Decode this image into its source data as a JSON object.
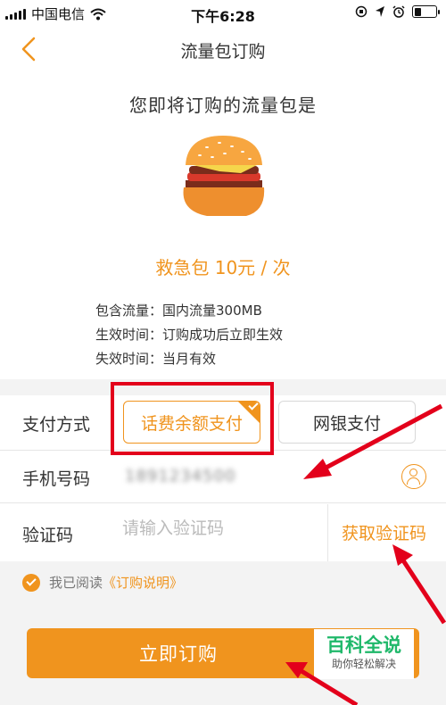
{
  "status_bar": {
    "carrier": "中国电信",
    "time": "下午6:28"
  },
  "nav": {
    "title": "流量包订购"
  },
  "subtitle": "您即将订购的流量包是",
  "package": {
    "name": "救急包 10元 / 次",
    "details": [
      {
        "label": "包含流量：",
        "value": "国内流量300MB"
      },
      {
        "label": "生效时间：",
        "value": "订购成功后立即生效"
      },
      {
        "label": "失效时间：",
        "value": "当月有效"
      }
    ]
  },
  "payment": {
    "label": "支付方式",
    "options": [
      "话费余额支付",
      "网银支付"
    ],
    "selected": "话费余额支付"
  },
  "phone": {
    "label": "手机号码",
    "value": "1891234500"
  },
  "verify": {
    "label": "验证码",
    "placeholder": "请输入验证码",
    "get_code": "获取验证码"
  },
  "agreement": {
    "text": "我已阅读",
    "link": "《订购说明》"
  },
  "buy_button": "立即订购",
  "watermark": {
    "title": "百科全说",
    "subtitle": "助你轻松解决"
  },
  "colors": {
    "accent": "#f0941e",
    "annotation_red": "#e3001b",
    "watermark_green": "#1fb86a"
  }
}
